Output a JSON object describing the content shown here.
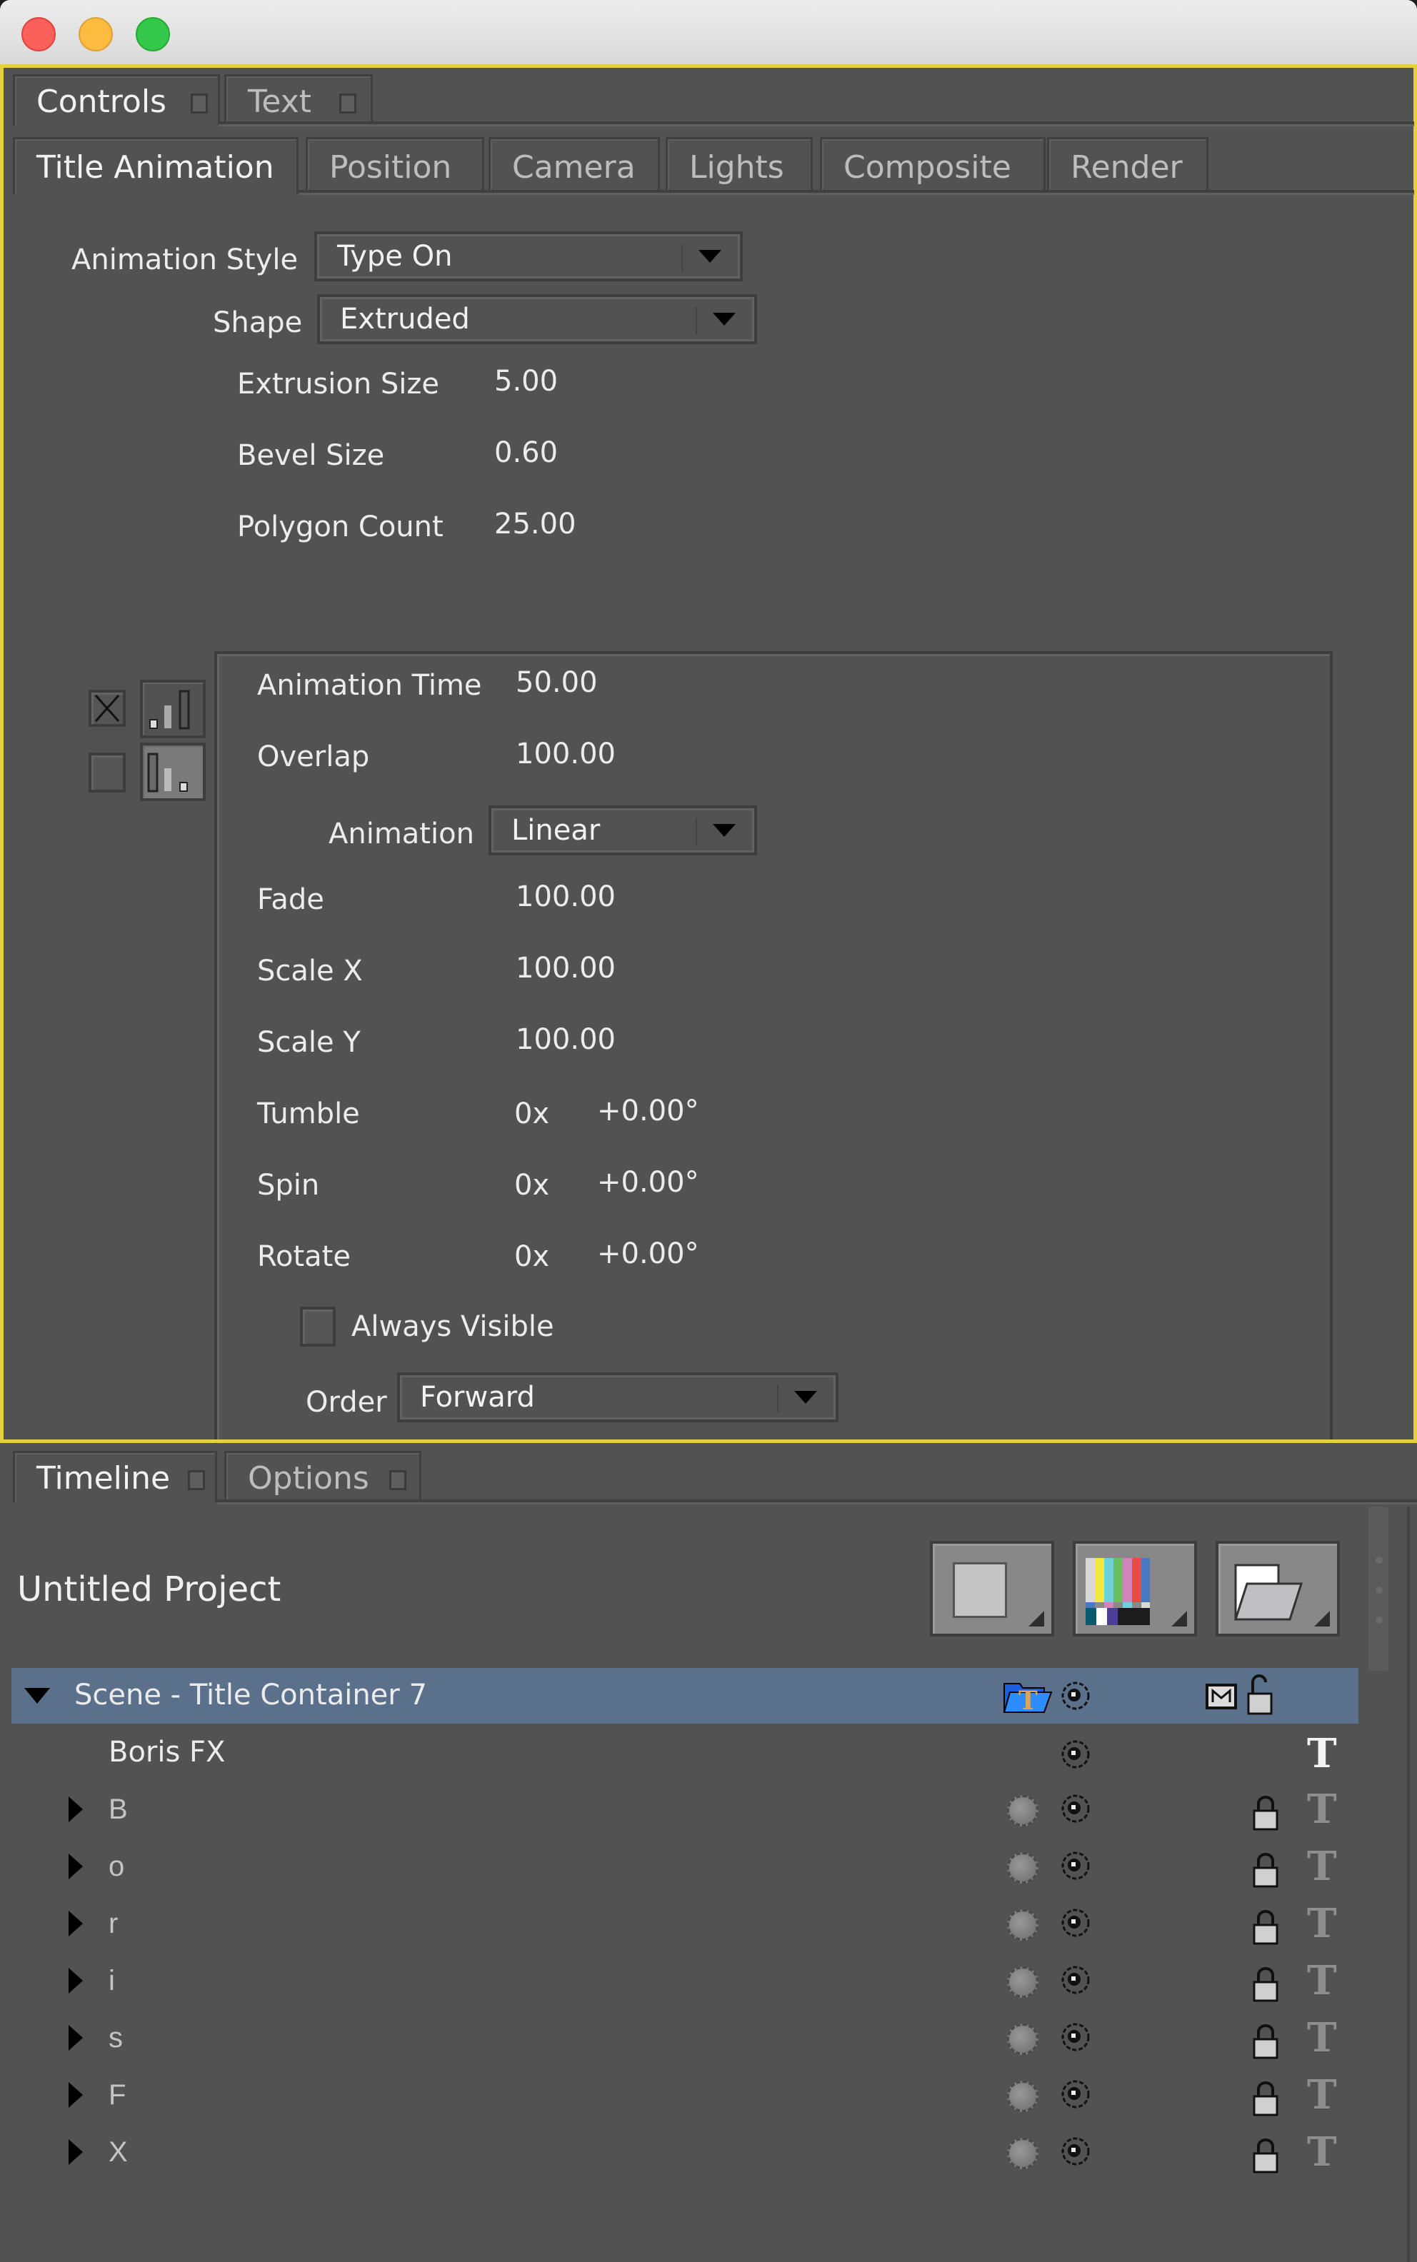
{
  "window": {
    "traffic_lights": {
      "close": "#fc605b",
      "minimize": "#fdbc40",
      "zoom": "#34c84a"
    },
    "accent_color": "#e5cf3c",
    "selection_color": "#5b708a"
  },
  "top_panel": {
    "panel_tabs": [
      {
        "label": "Controls",
        "active": true
      },
      {
        "label": "Text",
        "active": false
      }
    ],
    "section_tabs": [
      {
        "label": "Title Animation",
        "active": true
      },
      {
        "label": "Position",
        "active": false
      },
      {
        "label": "Camera",
        "active": false
      },
      {
        "label": "Lights",
        "active": false
      },
      {
        "label": "Composite",
        "active": false
      },
      {
        "label": "Render",
        "active": false
      }
    ],
    "animation_style": {
      "label": "Animation Style",
      "value": "Type On"
    },
    "shape": {
      "label": "Shape",
      "value": "Extruded"
    },
    "extrusion_size": {
      "label": "Extrusion Size",
      "value": "5.00"
    },
    "bevel_size": {
      "label": "Bevel Size",
      "value": "0.60"
    },
    "polygon_count": {
      "label": "Polygon Count",
      "value": "25.00"
    },
    "side_icons": {
      "row1_checkbox": "checked-x",
      "row1_icon": "ascending-bars-icon",
      "row2_checkbox": "unchecked",
      "row2_icon": "descending-bars-icon"
    },
    "group": {
      "animation_time": {
        "label": "Animation Time",
        "value": "50.00"
      },
      "overlap": {
        "label": "Overlap",
        "value": "100.00"
      },
      "animation": {
        "label": "Animation",
        "value": "Linear"
      },
      "fade": {
        "label": "Fade",
        "value": "100.00"
      },
      "scale_x": {
        "label": "Scale X",
        "value": "100.00"
      },
      "scale_y": {
        "label": "Scale Y",
        "value": "100.00"
      },
      "tumble": {
        "label": "Tumble",
        "turns": "0x",
        "degrees": "+0.00°"
      },
      "spin": {
        "label": "Spin",
        "turns": "0x",
        "degrees": "+0.00°"
      },
      "rotate": {
        "label": "Rotate",
        "turns": "0x",
        "degrees": "+0.00°"
      },
      "always_visible": {
        "label": "Always Visible",
        "checked": false
      },
      "order": {
        "label": "Order",
        "value": "Forward"
      }
    }
  },
  "bottom_panel": {
    "panel_tabs": [
      {
        "label": "Timeline",
        "active": true
      },
      {
        "label": "Options",
        "active": false
      }
    ],
    "project_title": "Untitled Project",
    "toolbar_buttons": [
      {
        "name": "new-layer-button",
        "icon": "blank-page-icon"
      },
      {
        "name": "color-bars-button",
        "icon": "color-bars-icon"
      },
      {
        "name": "open-folder-button",
        "icon": "folder-icon"
      }
    ],
    "tree": {
      "scene": {
        "label": "Scene - Title Container 7",
        "expanded": true
      },
      "text_layer": {
        "label": "Boris FX"
      },
      "letters": [
        "B",
        "o",
        "r",
        "i",
        "s",
        "F",
        "X"
      ]
    }
  }
}
